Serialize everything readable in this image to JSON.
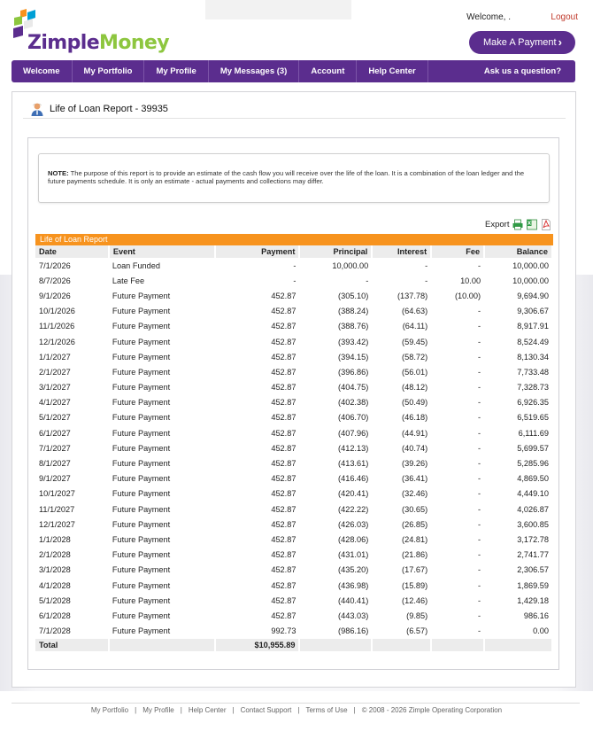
{
  "header": {
    "logo_zimple": "Zimple",
    "logo_money": "Money",
    "welcome": "Welcome, .",
    "logout": "Logout",
    "make_payment": "Make A Payment",
    "make_payment_chevron": "›"
  },
  "colors": {
    "brand_purple": "#5b2d8e",
    "brand_green": "#8dc63f",
    "report_orange": "#f7931e",
    "logout_red": "#c0392b"
  },
  "nav": {
    "items": [
      "Welcome",
      "My Portfolio",
      "My Profile",
      "My Messages (3)",
      "Account",
      "Help Center"
    ],
    "ask": "Ask us a question?"
  },
  "page": {
    "title": "Life of Loan Report - 39935",
    "title_icon": "user-icon"
  },
  "note": {
    "label": "NOTE:",
    "text": " The purpose of this report is to provide an estimate of the cash flow you will receive over the life of the loan. It is a combination of the loan ledger and the future payments schedule. It is only an estimate - actual payments and collections may differ."
  },
  "export": {
    "label": "Export",
    "icons": [
      "print-icon",
      "excel-icon",
      "pdf-icon"
    ]
  },
  "report": {
    "header": "Life of Loan Report",
    "columns": [
      "Date",
      "Event",
      "Payment",
      "Principal",
      "Interest",
      "Fee",
      "Balance"
    ],
    "rows": [
      [
        "7/1/2026",
        "Loan Funded",
        "-",
        "10,000.00",
        "-",
        "-",
        "10,000.00"
      ],
      [
        "8/7/2026",
        "Late Fee",
        "-",
        "-",
        "-",
        "10.00",
        "10,000.00"
      ],
      [
        "9/1/2026",
        "Future Payment",
        "452.87",
        "(305.10)",
        "(137.78)",
        "(10.00)",
        "9,694.90"
      ],
      [
        "10/1/2026",
        "Future Payment",
        "452.87",
        "(388.24)",
        "(64.63)",
        "-",
        "9,306.67"
      ],
      [
        "11/1/2026",
        "Future Payment",
        "452.87",
        "(388.76)",
        "(64.11)",
        "-",
        "8,917.91"
      ],
      [
        "12/1/2026",
        "Future Payment",
        "452.87",
        "(393.42)",
        "(59.45)",
        "-",
        "8,524.49"
      ],
      [
        "1/1/2027",
        "Future Payment",
        "452.87",
        "(394.15)",
        "(58.72)",
        "-",
        "8,130.34"
      ],
      [
        "2/1/2027",
        "Future Payment",
        "452.87",
        "(396.86)",
        "(56.01)",
        "-",
        "7,733.48"
      ],
      [
        "3/1/2027",
        "Future Payment",
        "452.87",
        "(404.75)",
        "(48.12)",
        "-",
        "7,328.73"
      ],
      [
        "4/1/2027",
        "Future Payment",
        "452.87",
        "(402.38)",
        "(50.49)",
        "-",
        "6,926.35"
      ],
      [
        "5/1/2027",
        "Future Payment",
        "452.87",
        "(406.70)",
        "(46.18)",
        "-",
        "6,519.65"
      ],
      [
        "6/1/2027",
        "Future Payment",
        "452.87",
        "(407.96)",
        "(44.91)",
        "-",
        "6,111.69"
      ],
      [
        "7/1/2027",
        "Future Payment",
        "452.87",
        "(412.13)",
        "(40.74)",
        "-",
        "5,699.57"
      ],
      [
        "8/1/2027",
        "Future Payment",
        "452.87",
        "(413.61)",
        "(39.26)",
        "-",
        "5,285.96"
      ],
      [
        "9/1/2027",
        "Future Payment",
        "452.87",
        "(416.46)",
        "(36.41)",
        "-",
        "4,869.50"
      ],
      [
        "10/1/2027",
        "Future Payment",
        "452.87",
        "(420.41)",
        "(32.46)",
        "-",
        "4,449.10"
      ],
      [
        "11/1/2027",
        "Future Payment",
        "452.87",
        "(422.22)",
        "(30.65)",
        "-",
        "4,026.87"
      ],
      [
        "12/1/2027",
        "Future Payment",
        "452.87",
        "(426.03)",
        "(26.85)",
        "-",
        "3,600.85"
      ],
      [
        "1/1/2028",
        "Future Payment",
        "452.87",
        "(428.06)",
        "(24.81)",
        "-",
        "3,172.78"
      ],
      [
        "2/1/2028",
        "Future Payment",
        "452.87",
        "(431.01)",
        "(21.86)",
        "-",
        "2,741.77"
      ],
      [
        "3/1/2028",
        "Future Payment",
        "452.87",
        "(435.20)",
        "(17.67)",
        "-",
        "2,306.57"
      ],
      [
        "4/1/2028",
        "Future Payment",
        "452.87",
        "(436.98)",
        "(15.89)",
        "-",
        "1,869.59"
      ],
      [
        "5/1/2028",
        "Future Payment",
        "452.87",
        "(440.41)",
        "(12.46)",
        "-",
        "1,429.18"
      ],
      [
        "6/1/2028",
        "Future Payment",
        "452.87",
        "(443.03)",
        "(9.85)",
        "-",
        "986.16"
      ],
      [
        "7/1/2028",
        "Future Payment",
        "992.73",
        "(986.16)",
        "(6.57)",
        "-",
        "0.00"
      ]
    ],
    "total_label": "Total",
    "total_payment": "$10,955.89"
  },
  "footer": {
    "links": [
      "My Portfolio",
      "My Profile",
      "Help Center",
      "Contact Support",
      "Terms of Use"
    ],
    "copyright": "© 2008 - 2026 Zimple Operating Corporation"
  }
}
